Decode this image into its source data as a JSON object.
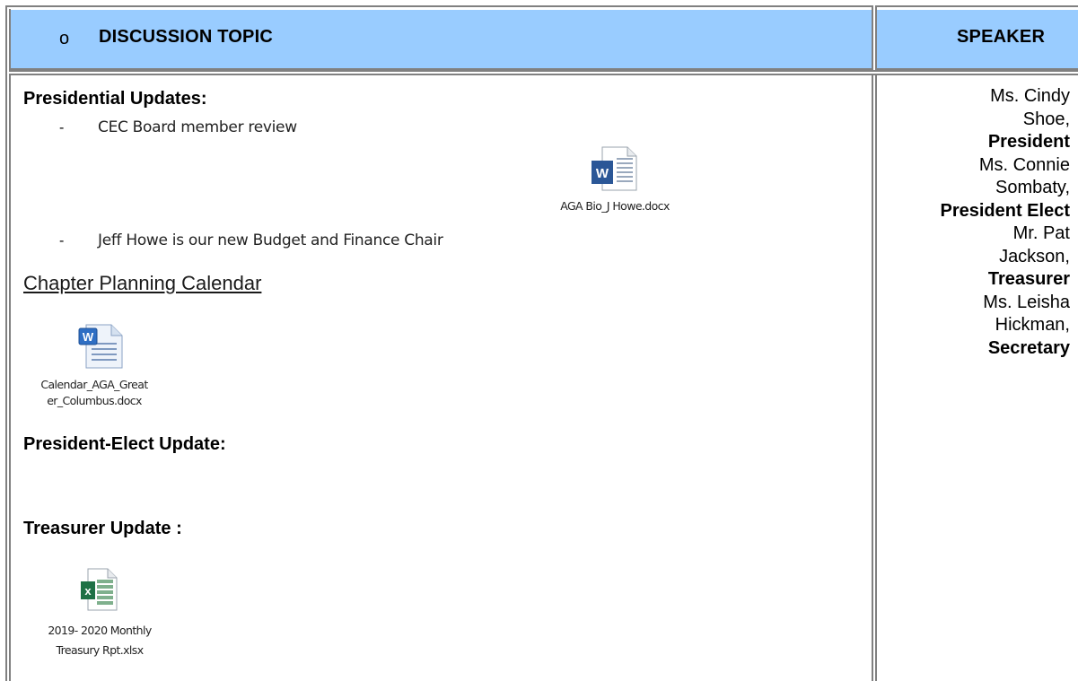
{
  "header": {
    "bullet": "o",
    "topic": "DISCUSSION TOPIC",
    "speaker": "SPEAKER"
  },
  "presidential": {
    "heading": "Presidential  Updates:",
    "items": [
      {
        "dash": "-",
        "text": "CEC Board member review"
      },
      {
        "dash": "-",
        "text": "Jeff Howe is our new Budget and Finance Chair"
      }
    ],
    "attachment": {
      "caption": "AGA Bio_J Howe.docx",
      "icon": "word-doc-icon"
    }
  },
  "calendar": {
    "link": "Chapter Planning Calendar",
    "attachment": {
      "caption_line1": "Calendar_AGA_Great",
      "caption_line2": "er_Columbus.docx",
      "icon": "word-doc-icon"
    }
  },
  "president_elect": {
    "heading": "President-Elect Update:"
  },
  "treasurer": {
    "heading": "Treasurer Update :",
    "attachment": {
      "caption_line1": "2019- 2020 Monthly",
      "caption_line2": "Treasury Rpt.xlsx",
      "icon": "excel-sheet-icon"
    }
  },
  "speakers": [
    {
      "name_line1": "Ms. Cindy",
      "name_line2": "Shoe,",
      "role": "President"
    },
    {
      "name_line1": "Ms. Connie",
      "name_line2": "Sombaty,",
      "role": "President Elect"
    },
    {
      "name_line1": "Mr. Pat",
      "name_line2": "Jackson,",
      "role": "Treasurer"
    },
    {
      "name_line1": "Ms. Leisha",
      "name_line2": "Hickman,",
      "role": "Secretary"
    }
  ],
  "colors": {
    "header_bg": "#99ccff",
    "border": "#808080",
    "word_blue": "#2b5797",
    "excel_green": "#1e7145"
  }
}
